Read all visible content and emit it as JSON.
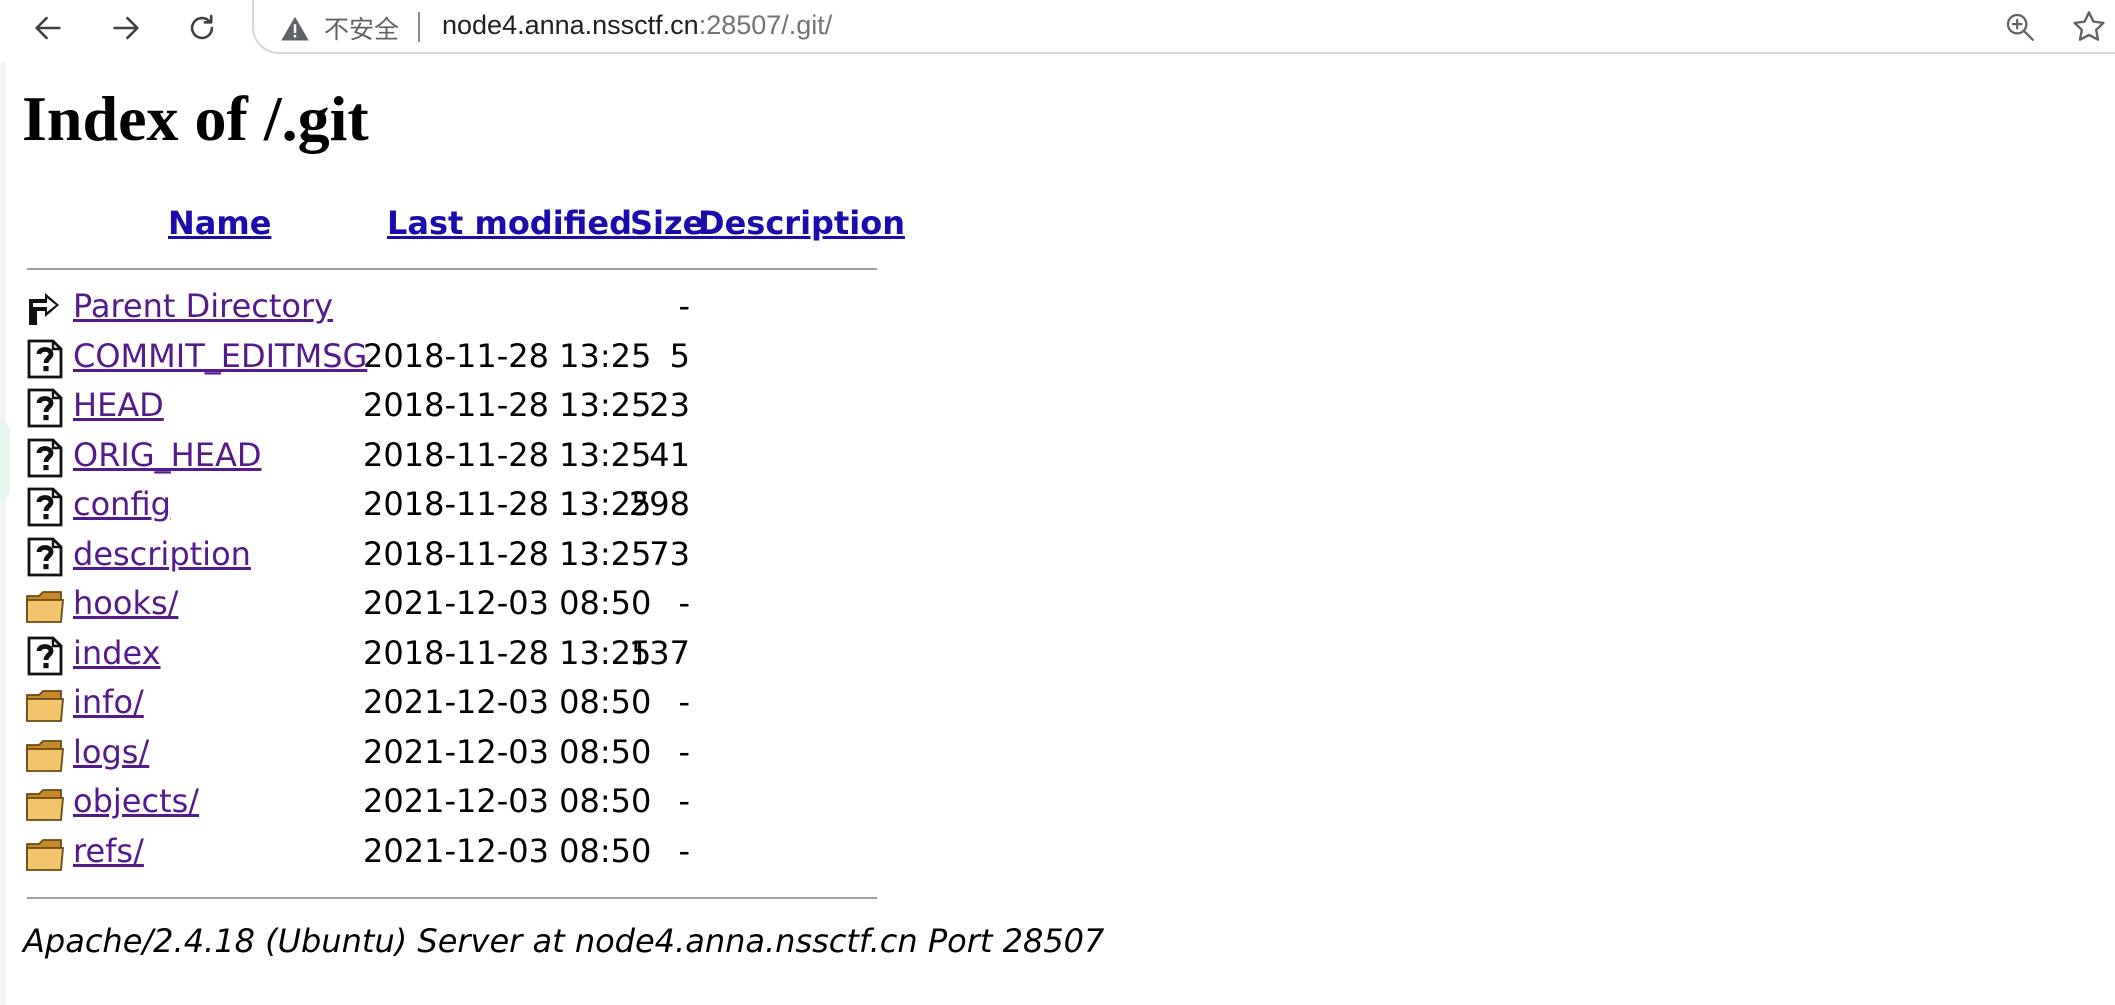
{
  "browser": {
    "security_label": "不安全",
    "url_host": "node4.anna.nssctf.cn",
    "url_rest": ":28507/.git/"
  },
  "page": {
    "title": "Index of /.git",
    "columns": {
      "name": "Name",
      "last_modified": "Last modified",
      "size": "Size",
      "description": "Description"
    },
    "rows": [
      {
        "name": "Parent Directory",
        "date": "",
        "size": "-",
        "icon": "back-icon"
      },
      {
        "name": "COMMIT_EDITMSG",
        "date": "2018-11-28 13:25",
        "size": "5",
        "icon": "unknown-file-icon"
      },
      {
        "name": "HEAD",
        "date": "2018-11-28 13:25",
        "size": "23",
        "icon": "unknown-file-icon"
      },
      {
        "name": "ORIG_HEAD",
        "date": "2018-11-28 13:25",
        "size": "41",
        "icon": "unknown-file-icon"
      },
      {
        "name": "config",
        "date": "2018-11-28 13:25",
        "size": "298",
        "icon": "unknown-file-icon"
      },
      {
        "name": "description",
        "date": "2018-11-28 13:25",
        "size": "73",
        "icon": "unknown-file-icon"
      },
      {
        "name": "hooks/",
        "date": "2021-12-03 08:50",
        "size": "-",
        "icon": "folder-icon"
      },
      {
        "name": "index",
        "date": "2018-11-28 13:25",
        "size": "137",
        "icon": "unknown-file-icon"
      },
      {
        "name": "info/",
        "date": "2021-12-03 08:50",
        "size": "-",
        "icon": "folder-icon"
      },
      {
        "name": "logs/",
        "date": "2021-12-03 08:50",
        "size": "-",
        "icon": "folder-icon"
      },
      {
        "name": "objects/",
        "date": "2021-12-03 08:50",
        "size": "-",
        "icon": "folder-icon"
      },
      {
        "name": "refs/",
        "date": "2021-12-03 08:50",
        "size": "-",
        "icon": "folder-icon"
      }
    ],
    "footer": "Apache/2.4.18 (Ubuntu) Server at node4.anna.nssctf.cn Port 28507"
  },
  "colors": {
    "link": "#1a0dab",
    "visited_link": "#551a8b",
    "folder": "#f2c46b",
    "rule": "#a0a0a0"
  }
}
